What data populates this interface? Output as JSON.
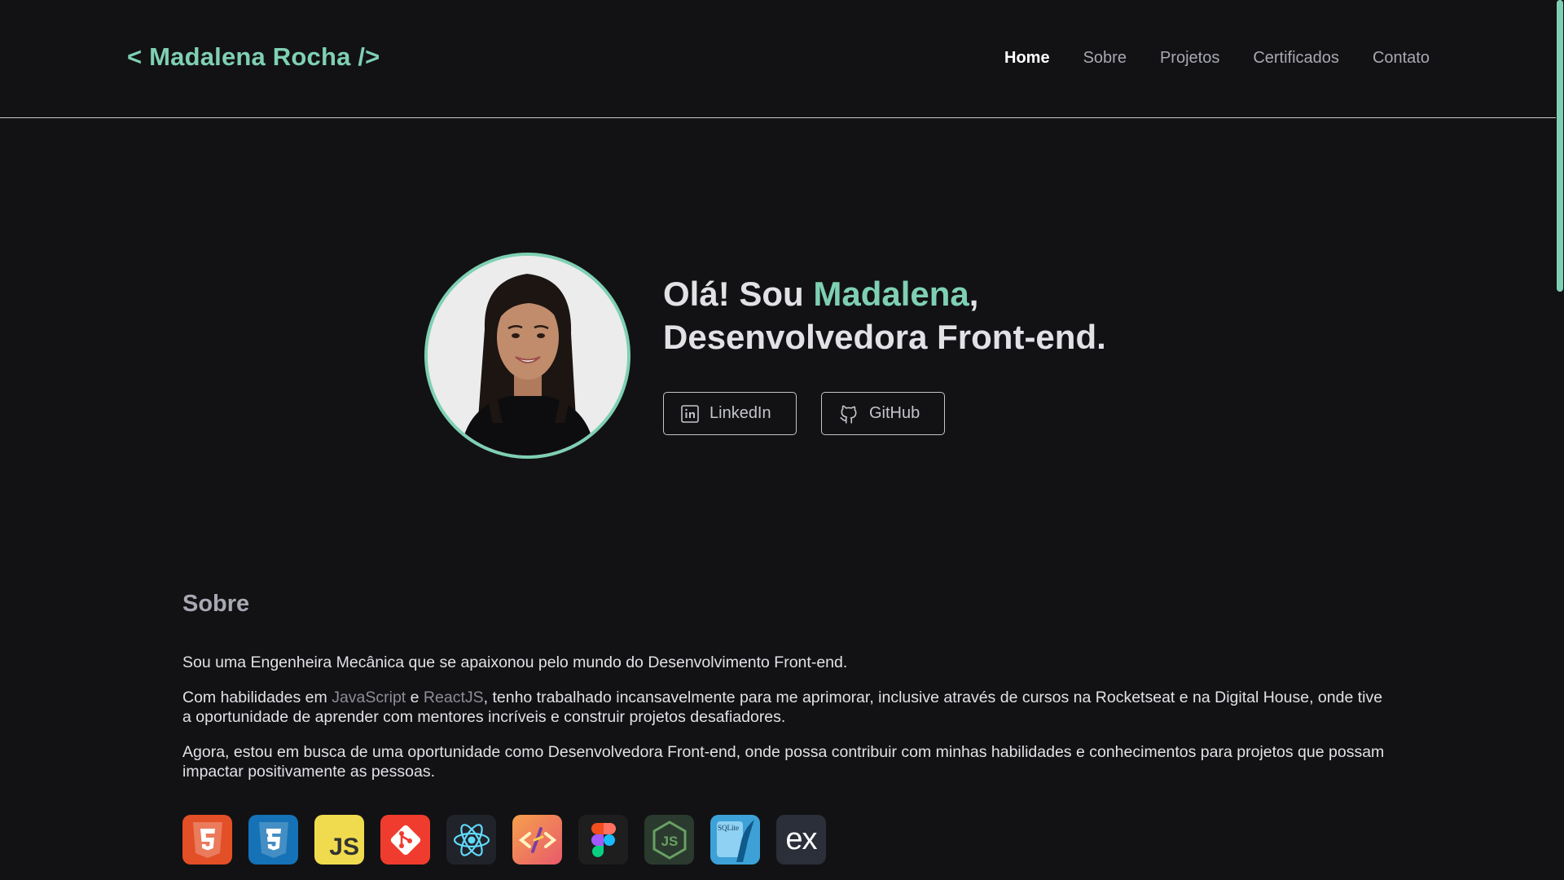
{
  "header": {
    "logo": "< Madalena Rocha />",
    "nav": [
      "Home",
      "Sobre",
      "Projetos",
      "Certificados",
      "Contato"
    ]
  },
  "hero": {
    "greeting_prefix": "Olá! Sou ",
    "name": "Madalena",
    "greeting_suffix": ",",
    "role": "Desenvolvedora Front-end.",
    "linkedin_label": "LinkedIn",
    "github_label": "GitHub"
  },
  "about": {
    "title": "Sobre",
    "p1": "Sou uma Engenheira Mecânica que se apaixonou pelo mundo do Desenvolvimento Front-end.",
    "p2_a": "Com habilidades em ",
    "p2_js": "JavaScript",
    "p2_b": " e ",
    "p2_react": "ReactJS",
    "p2_c": ", tenho trabalhado incansavelmente para me aprimorar, inclusive através de cursos na Rocketseat e na Digital House, onde tive a oportunidade de aprender com mentores incríveis e construir projetos desafiadores.",
    "p3": "Agora, estou em busca de uma oportunidade como Desenvolvedora Front-end, onde possa contribuir com minhas habilidades e conhecimentos para projetos que possam impactar positivamente as pessoas."
  },
  "skills": [
    "html5-icon",
    "css3-icon",
    "javascript-icon",
    "git-icon",
    "react-icon",
    "storybook-icon",
    "figma-icon",
    "nodejs-icon",
    "sqlite-icon",
    "express-icon"
  ],
  "skill_texts": {
    "js": "JS",
    "sqlite": "SQLite",
    "express": "ex"
  },
  "colors": {
    "accent": "#7fd0b3",
    "background": "#121214"
  }
}
